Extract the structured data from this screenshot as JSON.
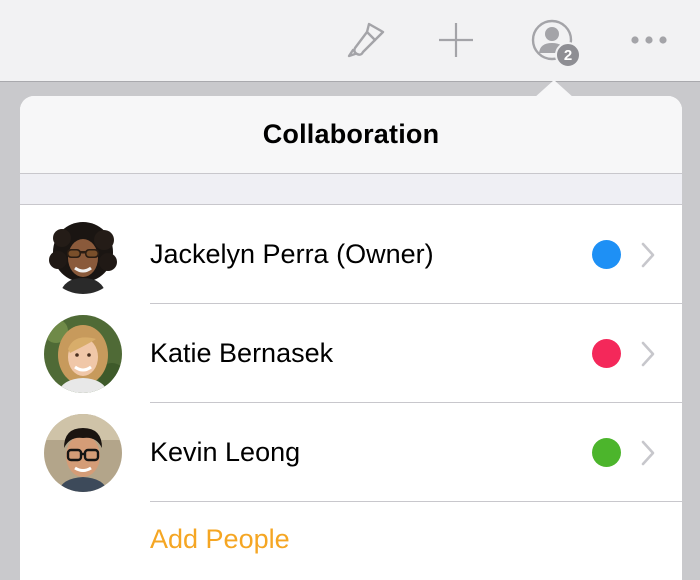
{
  "toolbar": {
    "icons": [
      "paintbrush-icon",
      "plus-icon",
      "collaboration-icon",
      "more-icon"
    ],
    "collaborator_count": "2"
  },
  "popover": {
    "title": "Collaboration",
    "collaborators": [
      {
        "name": "Jackelyn Perra (Owner)",
        "color": "#1e90f5"
      },
      {
        "name": "Katie Bernasek",
        "color": "#f4285a"
      },
      {
        "name": "Kevin Leong",
        "color": "#4cb52c"
      }
    ],
    "add_label": "Add People"
  },
  "colors": {
    "accent": "#f5a623",
    "toolbar_icon": "#a4a4a8"
  }
}
